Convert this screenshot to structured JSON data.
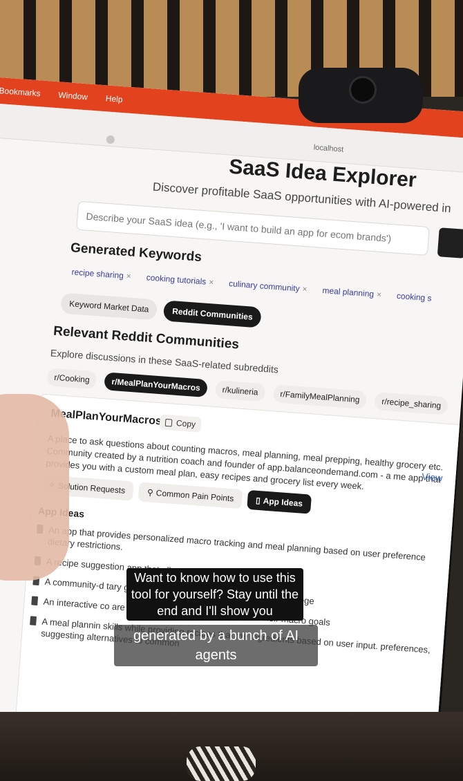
{
  "os_menu": [
    "Bookmarks",
    "Window",
    "Help"
  ],
  "browser": {
    "url": "localhost"
  },
  "app": {
    "title": "SaaS Idea Explorer",
    "subtitle": "Discover profitable SaaS opportunities with AI-powered in",
    "search_placeholder": "Describe your SaaS idea (e.g., 'I want to build an app for ecom brands')"
  },
  "keywords": {
    "heading": "Generated Keywords",
    "items": [
      "recipe sharing",
      "cooking tutorials",
      "culinary community",
      "meal planning",
      "cooking s"
    ],
    "remove_glyph": "×"
  },
  "view_tabs": {
    "market": "Keyword Market Data",
    "reddit": "Reddit Communities"
  },
  "communities": {
    "heading": "Relevant Reddit Communities",
    "subheading": "Explore discussions in these SaaS-related subreddits",
    "items": [
      "r/Cooking",
      "r/MealPlanYourMacros",
      "r/kulineria",
      "r/FamilyMealPlanning",
      "r/recipe_sharing"
    ]
  },
  "card": {
    "title": "MealPlanYourMacros",
    "copy_label": "Copy",
    "view_label": "View",
    "description": "A place to ask questions about counting macros, meal planning, meal prepping, healthy grocery etc. Community created by a nutrition coach and founder of app.balanceondemand.com - a me app that provides you with a custom meal plan, easy recipes and grocery list every week.",
    "tabs": {
      "solution": "Solution Requests",
      "pain": "Common Pain Points",
      "ideas": "App Ideas"
    },
    "ideas_heading": "App Ideas",
    "ideas": [
      "An app that provides personalized macro tracking and meal planning based on user preference dietary restrictions.",
      "A recipe suggestion app that allows use tailored meal plans.",
      "A community-d tary goals and restrictions, generatin like 5:2 or vege",
      "An interactive co are and rate recipes based on specifi their macro goals",
      "A meal plannin skills while providing recipes that me ingredients based on user input. preferences, suggesting alternatives to common"
    ]
  },
  "captions": {
    "top": "Want to know how to use this tool for yourself? Stay until the end and I'll show you",
    "bottom": "generated by a bunch of AI agents"
  }
}
